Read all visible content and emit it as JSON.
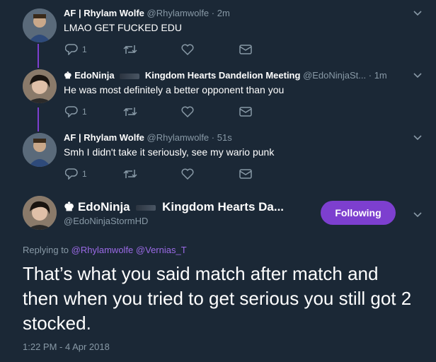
{
  "tweets": [
    {
      "name": "AF | Rhylam Wolfe",
      "handle": "@Rhylamwolfe",
      "time": "· 2m",
      "text": "LMAO GET FUCKED EDU",
      "reply_count": "1"
    },
    {
      "name_prefix": "♚ EdoNinja",
      "name_suffix": "Kingdom Hearts Dandelion Meeting",
      "handle": "@EdoNinjaSt...",
      "time": "· 1m",
      "text": "He was most definitely a better opponent than you",
      "reply_count": "1"
    },
    {
      "name": "AF | Rhylam Wolfe",
      "handle": "@Rhylamwolfe",
      "time": "· 51s",
      "text": "Smh I didn't take it seriously, see my wario punk",
      "reply_count": "1"
    }
  ],
  "main_tweet": {
    "name_prefix": "♚ EdoNinja",
    "name_suffix": "Kingdom Hearts Da...",
    "handle": "@EdoNinjaStormHD",
    "follow_label": "Following",
    "replying_label": "Replying to",
    "replying_to_1": "@Rhylamwolfe",
    "replying_to_2": "@Vernias_T",
    "text": "That’s what you said match after match and then when you tried to get serious you still got 2 stocked.",
    "timestamp": "1:22 PM - 4 Apr 2018"
  },
  "colors": {
    "background": "#1b2836",
    "accent": "#7d3fcf",
    "muted": "#8899a6",
    "link": "#9b6ae6"
  },
  "icons": [
    "reply-icon",
    "retweet-icon",
    "like-icon",
    "dm-icon",
    "chevron-down-icon",
    "crown-icon"
  ]
}
